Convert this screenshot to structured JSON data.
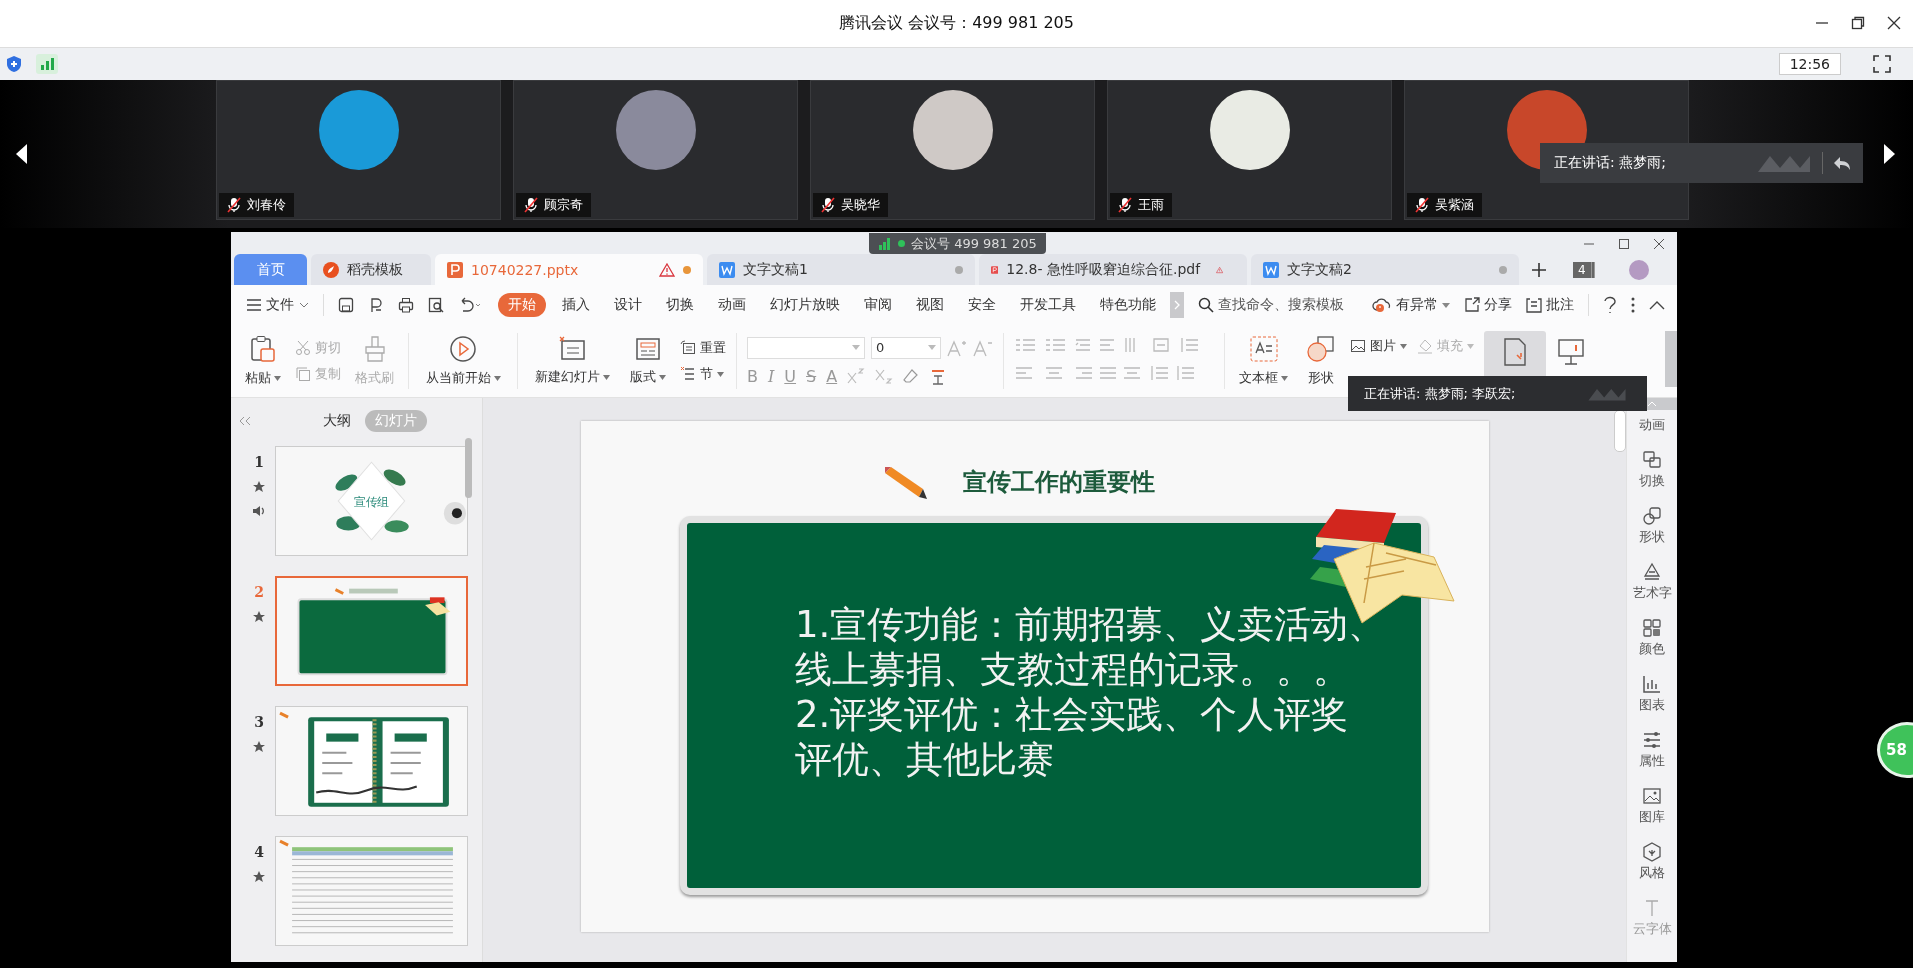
{
  "window": {
    "title": "腾讯会议 会议号：499 981 205"
  },
  "status_bar": {
    "time": "12:56"
  },
  "participants": [
    {
      "name": "刘春伶",
      "muted": true,
      "color": "#1a9ad8"
    },
    {
      "name": "顾宗奇",
      "muted": true,
      "color": "#8a8a9c"
    },
    {
      "name": "吴晓华",
      "muted": true,
      "color": "#cfc9c6"
    },
    {
      "name": "王雨",
      "muted": true,
      "color": "#e9ebe4"
    },
    {
      "name": "吴紫涵",
      "muted": true,
      "color": "#c8472a"
    }
  ],
  "speaking_tooltips": [
    "正在讲话: 燕梦雨;",
    "正在讲话: 燕梦雨; 李跃宏;"
  ],
  "meeting_badge": "会议号 499 981 205",
  "wps": {
    "tabs": [
      {
        "label": "首页",
        "kind": "home",
        "selected": false
      },
      {
        "label": "稻壳模板",
        "kind": "docer",
        "selected": false
      },
      {
        "label": "10740227.pptx",
        "kind": "ppt",
        "selected": true,
        "warning": true,
        "unsaved": true
      },
      {
        "label": "文字文稿1",
        "kind": "doc",
        "selected": false,
        "warning": false,
        "unsaved": true
      },
      {
        "label": "12.8- 急性呼吸窘迫综合征.pdf",
        "kind": "pdf",
        "selected": false,
        "warning": true,
        "unsaved": false
      },
      {
        "label": "文字文稿2",
        "kind": "doc",
        "selected": false,
        "warning": false,
        "unsaved": true
      }
    ],
    "window_count": "4",
    "file_menu": "文件",
    "menu": [
      {
        "label": "开始",
        "selected": true
      },
      {
        "label": "插入",
        "selected": false
      },
      {
        "label": "设计",
        "selected": false
      },
      {
        "label": "切换",
        "selected": false
      },
      {
        "label": "动画",
        "selected": false
      },
      {
        "label": "幻灯片放映",
        "selected": false
      },
      {
        "label": "审阅",
        "selected": false
      },
      {
        "label": "视图",
        "selected": false
      },
      {
        "label": "安全",
        "selected": false
      },
      {
        "label": "开发工具",
        "selected": false
      },
      {
        "label": "特色功能",
        "selected": false
      }
    ],
    "search": "查找命令、搜索模板",
    "actions": [
      "有异常",
      "分享",
      "批注"
    ],
    "ribbon": {
      "paste": "粘贴",
      "clipboard": [
        {
          "label": "剪切",
          "disabled": true
        },
        {
          "label": "复制",
          "disabled": true
        }
      ],
      "format_painter": {
        "label": "格式刷",
        "disabled": true
      },
      "play_from_current": "从当前开始",
      "new_slide": "新建幻灯片",
      "layout": "版式",
      "reset": "重置",
      "section": "节",
      "font_size": "0",
      "format_buttons": [
        "B",
        "I",
        "U",
        "S",
        "A"
      ],
      "text_box": "文本框",
      "shape": "形状",
      "picture": "图片",
      "fill": {
        "label": "填充",
        "disabled": true
      }
    },
    "panel_tabs": [
      {
        "label": "大纲",
        "selected": false
      },
      {
        "label": "幻灯片",
        "selected": true
      }
    ],
    "slides": [
      {
        "number": "1",
        "kind": "cover",
        "title": "宣传组",
        "selected": false,
        "audio": true
      },
      {
        "number": "2",
        "kind": "board",
        "selected": true,
        "audio": false
      },
      {
        "number": "3",
        "kind": "notebook",
        "selected": false,
        "audio": false
      },
      {
        "number": "4",
        "kind": "table",
        "selected": false,
        "audio": false
      }
    ],
    "slide": {
      "title": "宣传工作的重要性",
      "lines": [
        "1.宣传功能：前期招募、义卖活动、",
        "线上募捐、支教过程的记录。。。",
        "2.评奖评优：社会实践、个人评奖",
        "评优、其他比赛"
      ]
    },
    "sidebar_tools": [
      {
        "label": "动画",
        "kind": "animation",
        "disabled": false
      },
      {
        "label": "切换",
        "kind": "transition",
        "disabled": false
      },
      {
        "label": "形状",
        "kind": "shape",
        "disabled": false
      },
      {
        "label": "艺术字",
        "kind": "wordart",
        "disabled": false
      },
      {
        "label": "颜色",
        "kind": "color",
        "disabled": false
      },
      {
        "label": "图表",
        "kind": "chart",
        "disabled": false
      },
      {
        "label": "属性",
        "kind": "properties",
        "disabled": false
      },
      {
        "label": "图库",
        "kind": "gallery",
        "disabled": false
      },
      {
        "label": "风格",
        "kind": "style",
        "disabled": false
      },
      {
        "label": "云字体",
        "kind": "font",
        "disabled": true
      }
    ]
  },
  "timer_badge": "58"
}
